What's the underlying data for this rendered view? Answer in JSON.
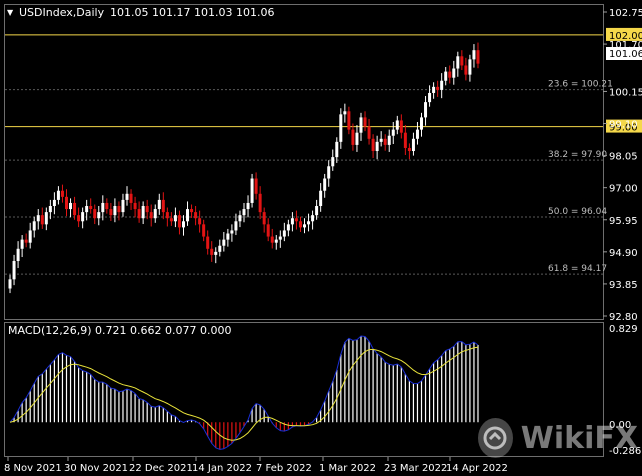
{
  "header": {
    "arrow": "▼",
    "symbol": "USDIndex,Daily",
    "ohlc": "101.05 101.17 101.03 101.06"
  },
  "price_axis": {
    "ticks": [
      "102.75",
      "101.70",
      "100.15",
      "99.10",
      "98.05",
      "97.00",
      "95.95",
      "94.90",
      "93.85",
      "92.80"
    ],
    "ymin": 92.8,
    "ymax": 102.75,
    "current_price": "101.06",
    "levels": [
      {
        "label": "102.00",
        "value": 102.0
      },
      {
        "label": "99.00",
        "value": 99.0
      }
    ]
  },
  "fib_levels": [
    {
      "label": "23.6 = 100.21",
      "value": 100.21
    },
    {
      "label": "38.2 = 97.90",
      "value": 97.9
    },
    {
      "label": "50.0 = 96.04",
      "value": 96.04
    },
    {
      "label": "61.8 = 94.17",
      "value": 94.17
    }
  ],
  "macd": {
    "label": "MACD(12,26,9) 0.721 0.662 0.077 0.000",
    "top_label": "0.829",
    "zero_label": "0.00",
    "bottom_label": "-0.286",
    "ymin": -0.286,
    "ymax": 0.829
  },
  "time_axis": [
    "8 Nov 2021",
    "30 Nov 2021",
    "22 Dec 2021",
    "14 Jan 2022",
    "7 Feb 2022",
    "1 Mar 2022",
    "23 Mar 2022",
    "14 Apr 2022"
  ],
  "watermark": "WikiFX",
  "colors": {
    "bull": "#ffffff",
    "bear": "#e31414",
    "level_line": "#f5d84a",
    "macd_line": "#1a2fd6",
    "signal_line": "#e8e23a",
    "grid": "#5a5a5a"
  },
  "chart_data": {
    "type": "candlestick",
    "closes": [
      94.0,
      94.6,
      95.0,
      95.3,
      95.2,
      95.6,
      95.9,
      96.1,
      95.8,
      96.2,
      96.4,
      96.6,
      96.9,
      96.7,
      96.3,
      96.5,
      96.1,
      95.9,
      96.2,
      96.4,
      96.3,
      96.0,
      96.2,
      96.5,
      96.3,
      96.1,
      96.4,
      96.2,
      96.6,
      96.8,
      96.5,
      96.3,
      96.0,
      96.4,
      96.2,
      96.0,
      96.3,
      96.6,
      96.2,
      96.0,
      95.9,
      96.1,
      95.7,
      95.9,
      96.3,
      96.2,
      96.0,
      95.8,
      95.4,
      95.0,
      94.8,
      94.9,
      95.1,
      95.3,
      95.5,
      95.6,
      95.9,
      96.1,
      96.3,
      96.5,
      97.3,
      96.8,
      96.2,
      95.8,
      95.4,
      95.2,
      95.3,
      95.4,
      95.6,
      95.8,
      96.0,
      95.9,
      95.7,
      95.8,
      95.9,
      96.1,
      96.4,
      96.9,
      97.3,
      97.7,
      98.0,
      98.5,
      99.4,
      99.5,
      98.9,
      98.4,
      98.8,
      99.3,
      99.0,
      98.6,
      98.2,
      98.5,
      98.6,
      98.4,
      98.7,
      98.9,
      99.2,
      98.8,
      98.3,
      98.2,
      98.6,
      98.9,
      99.3,
      99.8,
      100.1,
      100.3,
      100.2,
      100.5,
      100.8,
      100.6,
      100.9,
      101.3,
      101.0,
      100.7,
      101.2,
      101.5,
      101.06
    ]
  }
}
